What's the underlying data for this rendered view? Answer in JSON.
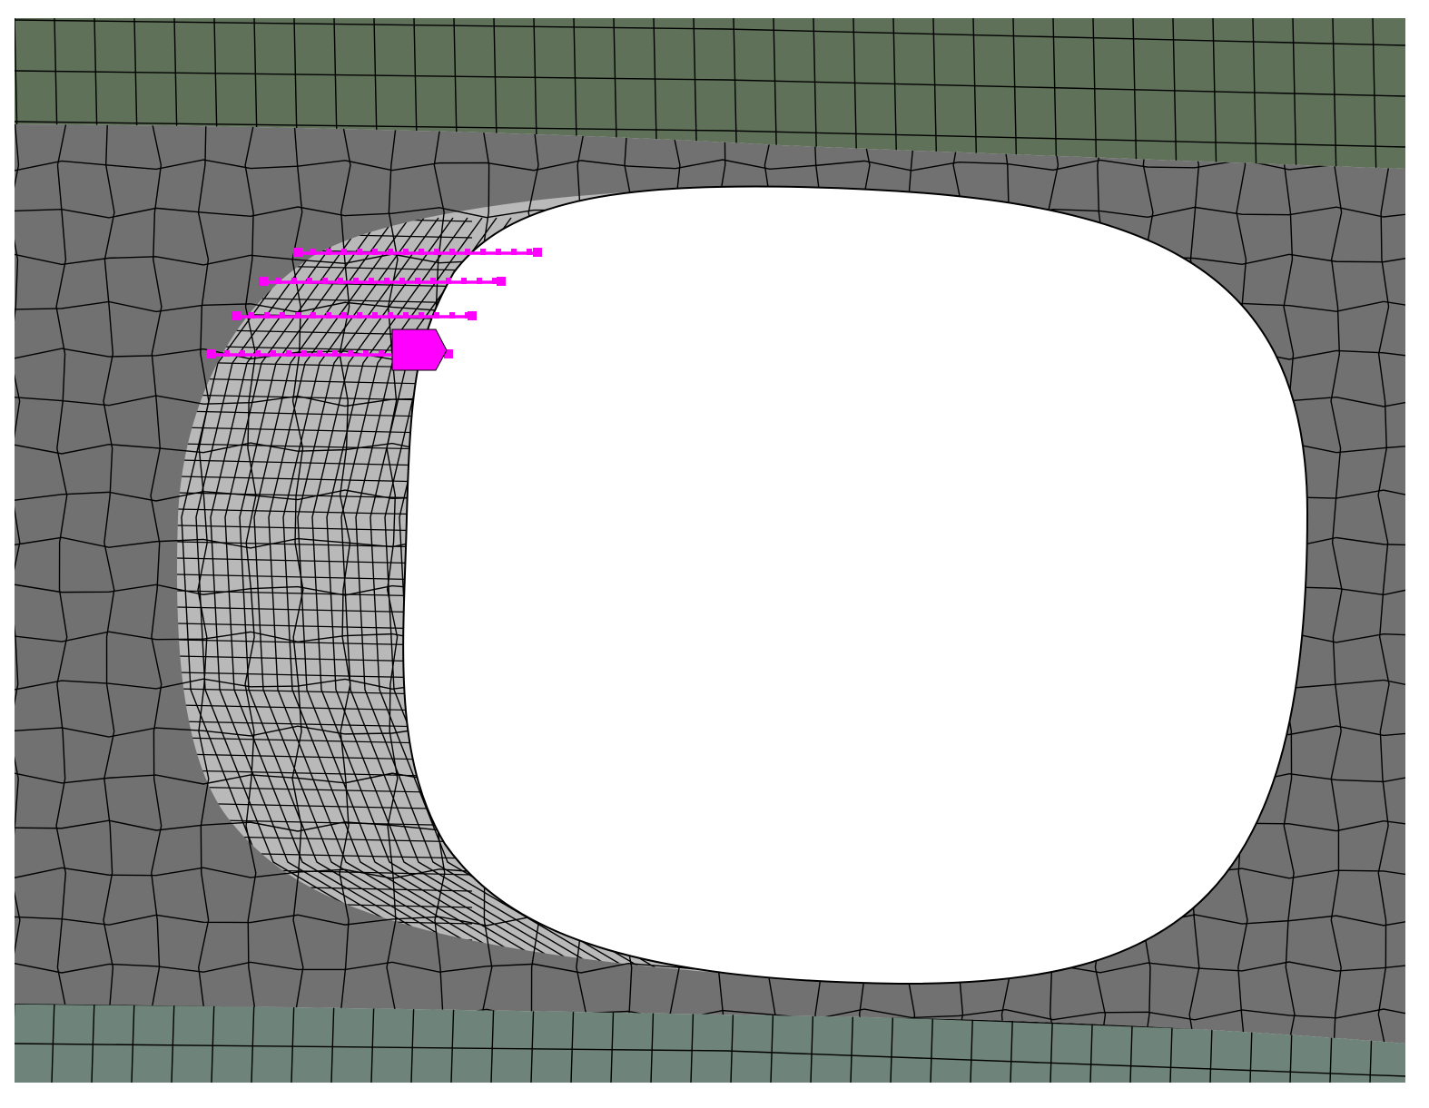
{
  "viewport": {
    "background_color": "#ffffff",
    "colors": {
      "top_band": "#5f7158",
      "plate": "#717171",
      "bottom_band": "#6e837a",
      "hole_wall": "#b9b9b9",
      "hole": "#ffffff",
      "mesh_edge": "#000000",
      "selection": "#ff00ff"
    },
    "icons": [
      "selection-handle-icon"
    ],
    "selection_rows": 4
  }
}
